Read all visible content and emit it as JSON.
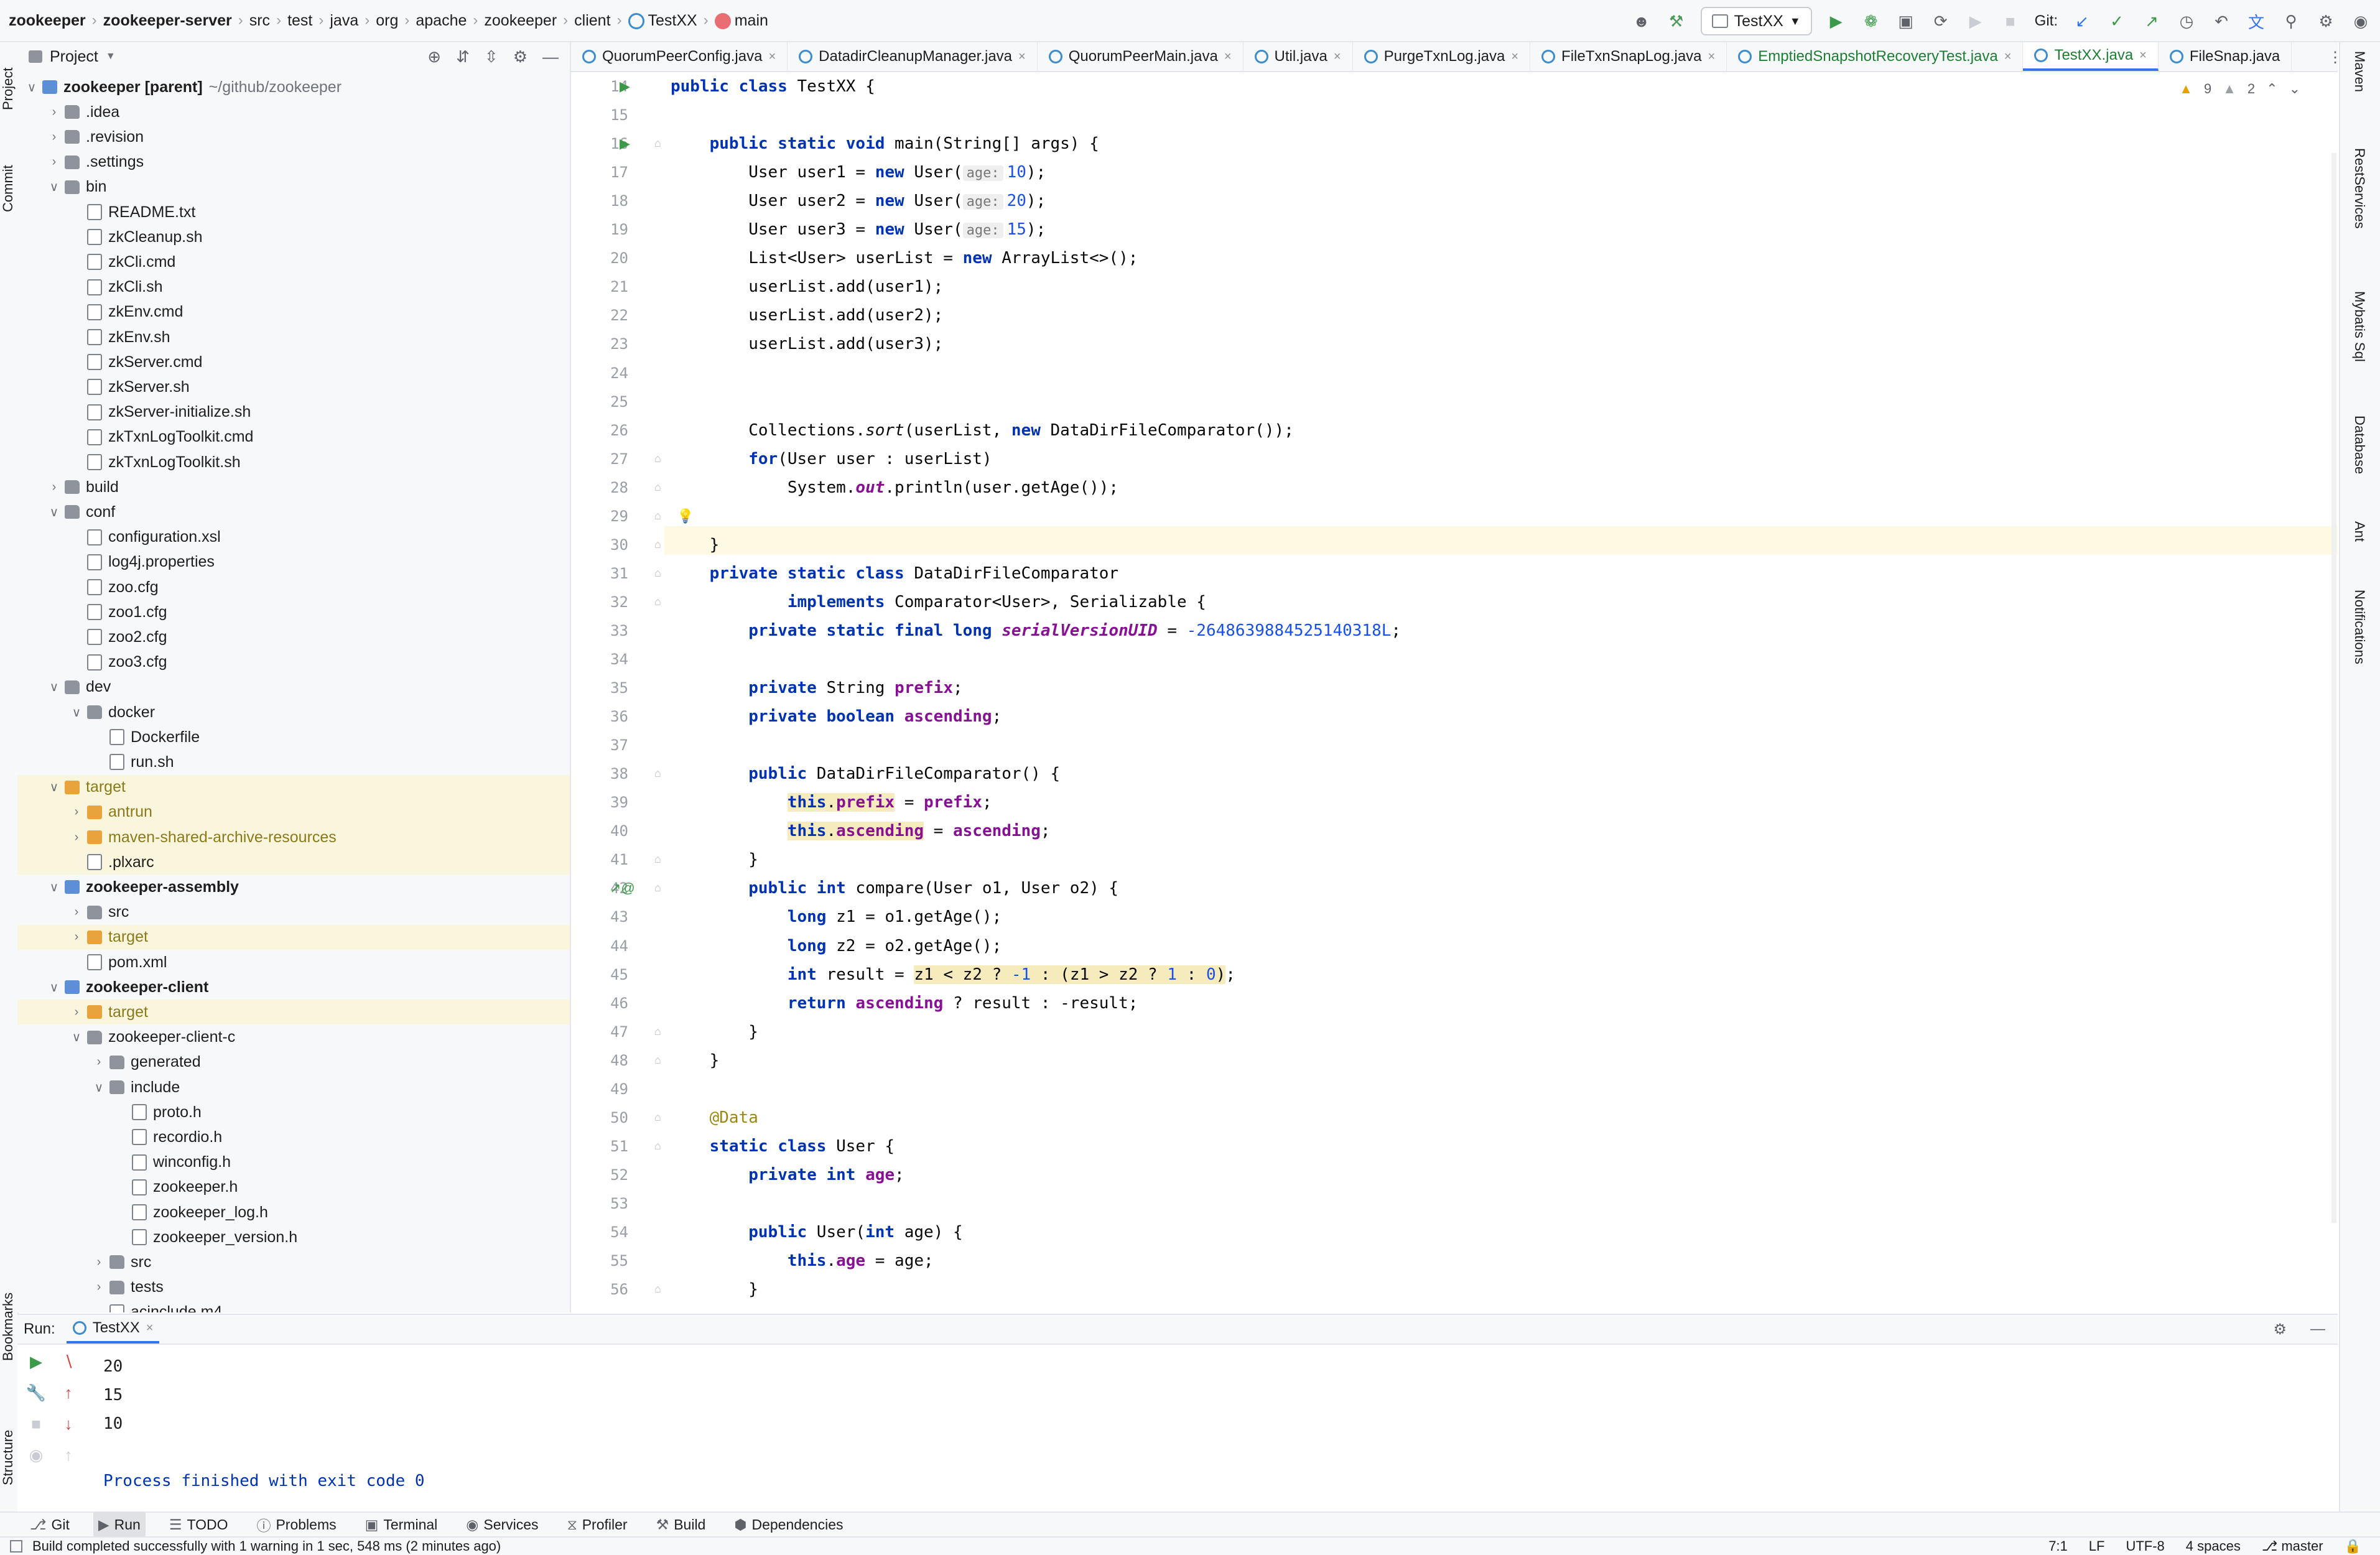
{
  "breadcrumbs": [
    "zookeeper",
    "zookeeper-server",
    "src",
    "test",
    "java",
    "org",
    "apache",
    "zookeeper",
    "client",
    "TestXX",
    "main"
  ],
  "toolbar": {
    "run_config": "TestXX",
    "git_label": "Git:"
  },
  "left_stripe": {
    "project": "Project",
    "commit": "Commit",
    "bookmarks": "Bookmarks",
    "structure": "Structure"
  },
  "right_stripe": [
    "Maven",
    "RestServices",
    "Mybatis Sql",
    "Database",
    "Ant",
    "Notifications"
  ],
  "project_panel": {
    "title": "Project",
    "tree": [
      {
        "label": "zookeeper [parent]",
        "path": "~/github/zookeeper",
        "depth": 0,
        "arrow": "down",
        "icon": "mod",
        "bold": true
      },
      {
        "label": ".idea",
        "depth": 1,
        "arrow": "right",
        "icon": "folder"
      },
      {
        "label": ".revision",
        "depth": 1,
        "arrow": "right",
        "icon": "folder"
      },
      {
        "label": ".settings",
        "depth": 1,
        "arrow": "right",
        "icon": "folder"
      },
      {
        "label": "bin",
        "depth": 1,
        "arrow": "down",
        "icon": "folder"
      },
      {
        "label": "README.txt",
        "depth": 2,
        "icon": "file"
      },
      {
        "label": "zkCleanup.sh",
        "depth": 2,
        "icon": "file"
      },
      {
        "label": "zkCli.cmd",
        "depth": 2,
        "icon": "file"
      },
      {
        "label": "zkCli.sh",
        "depth": 2,
        "icon": "file"
      },
      {
        "label": "zkEnv.cmd",
        "depth": 2,
        "icon": "file"
      },
      {
        "label": "zkEnv.sh",
        "depth": 2,
        "icon": "file"
      },
      {
        "label": "zkServer.cmd",
        "depth": 2,
        "icon": "file"
      },
      {
        "label": "zkServer.sh",
        "depth": 2,
        "icon": "file"
      },
      {
        "label": "zkServer-initialize.sh",
        "depth": 2,
        "icon": "file"
      },
      {
        "label": "zkTxnLogToolkit.cmd",
        "depth": 2,
        "icon": "file"
      },
      {
        "label": "zkTxnLogToolkit.sh",
        "depth": 2,
        "icon": "file"
      },
      {
        "label": "build",
        "depth": 1,
        "arrow": "right",
        "icon": "folder"
      },
      {
        "label": "conf",
        "depth": 1,
        "arrow": "down",
        "icon": "folder"
      },
      {
        "label": "configuration.xsl",
        "depth": 2,
        "icon": "file"
      },
      {
        "label": "log4j.properties",
        "depth": 2,
        "icon": "file"
      },
      {
        "label": "zoo.cfg",
        "depth": 2,
        "icon": "file"
      },
      {
        "label": "zoo1.cfg",
        "depth": 2,
        "icon": "file"
      },
      {
        "label": "zoo2.cfg",
        "depth": 2,
        "icon": "file"
      },
      {
        "label": "zoo3.cfg",
        "depth": 2,
        "icon": "file"
      },
      {
        "label": "dev",
        "depth": 1,
        "arrow": "down",
        "icon": "folder"
      },
      {
        "label": "docker",
        "depth": 2,
        "arrow": "down",
        "icon": "folder"
      },
      {
        "label": "Dockerfile",
        "depth": 3,
        "icon": "file"
      },
      {
        "label": "run.sh",
        "depth": 3,
        "icon": "file"
      },
      {
        "label": "target",
        "depth": 1,
        "arrow": "down",
        "icon": "ofolder",
        "hl": true
      },
      {
        "label": "antrun",
        "depth": 2,
        "arrow": "right",
        "icon": "ofolder",
        "hl": true
      },
      {
        "label": "maven-shared-archive-resources",
        "depth": 2,
        "arrow": "right",
        "icon": "ofolder",
        "hl": true
      },
      {
        "label": ".plxarc",
        "depth": 2,
        "icon": "file",
        "hl": true
      },
      {
        "label": "zookeeper-assembly",
        "depth": 1,
        "arrow": "down",
        "icon": "mod",
        "bold": true
      },
      {
        "label": "src",
        "depth": 2,
        "arrow": "right",
        "icon": "folder"
      },
      {
        "label": "target",
        "depth": 2,
        "arrow": "right",
        "icon": "ofolder",
        "hl": true
      },
      {
        "label": "pom.xml",
        "depth": 2,
        "icon": "file"
      },
      {
        "label": "zookeeper-client",
        "depth": 1,
        "arrow": "down",
        "icon": "mod",
        "bold": true
      },
      {
        "label": "target",
        "depth": 2,
        "arrow": "right",
        "icon": "ofolder",
        "hl": true
      },
      {
        "label": "zookeeper-client-c",
        "depth": 2,
        "arrow": "down",
        "icon": "folder"
      },
      {
        "label": "generated",
        "depth": 3,
        "arrow": "right",
        "icon": "folder"
      },
      {
        "label": "include",
        "depth": 3,
        "arrow": "down",
        "icon": "folder"
      },
      {
        "label": "proto.h",
        "depth": 4,
        "icon": "file"
      },
      {
        "label": "recordio.h",
        "depth": 4,
        "icon": "file"
      },
      {
        "label": "winconfig.h",
        "depth": 4,
        "icon": "file"
      },
      {
        "label": "zookeeper.h",
        "depth": 4,
        "icon": "file"
      },
      {
        "label": "zookeeper_log.h",
        "depth": 4,
        "icon": "file"
      },
      {
        "label": "zookeeper_version.h",
        "depth": 4,
        "icon": "file"
      },
      {
        "label": "src",
        "depth": 3,
        "arrow": "right",
        "icon": "folder"
      },
      {
        "label": "tests",
        "depth": 3,
        "arrow": "right",
        "icon": "folder"
      },
      {
        "label": "acinclude.m4",
        "depth": 3,
        "icon": "file"
      }
    ]
  },
  "tabs": [
    {
      "label": "QuorumPeerConfig.java",
      "green": false
    },
    {
      "label": "DatadirCleanupManager.java",
      "green": false
    },
    {
      "label": "QuorumPeerMain.java",
      "green": false
    },
    {
      "label": "Util.java",
      "green": false
    },
    {
      "label": "PurgeTxnLog.java",
      "green": false
    },
    {
      "label": "FileTxnSnapLog.java",
      "green": false
    },
    {
      "label": "EmptiedSnapshotRecoveryTest.java",
      "green": true
    },
    {
      "label": "TestXX.java",
      "green": true,
      "active": true
    },
    {
      "label": "FileSnap.java",
      "green": false
    }
  ],
  "inspection": {
    "warnings": "9",
    "weak_warnings": "2"
  },
  "code_lines": [
    {
      "n": 14,
      "html": "<span class='kw'>public class</span> TestXX {"
    },
    {
      "n": 15,
      "html": ""
    },
    {
      "n": 16,
      "html": "    <span class='kw'>public static void</span> main(String[] args) {"
    },
    {
      "n": 17,
      "html": "        User user1 = <span class='kw'>new</span> User(<span class='hint'>age:</span><span class='num'>10</span>);"
    },
    {
      "n": 18,
      "html": "        User user2 = <span class='kw'>new</span> User(<span class='hint'>age:</span><span class='num'>20</span>);"
    },
    {
      "n": 19,
      "html": "        User user3 = <span class='kw'>new</span> User(<span class='hint'>age:</span><span class='num'>15</span>);"
    },
    {
      "n": 20,
      "html": "        List&lt;User&gt; userList = <span class='kw'>new</span> ArrayList&lt;&gt;();"
    },
    {
      "n": 21,
      "html": "        userList.add(user1);"
    },
    {
      "n": 22,
      "html": "        userList.add(user2);"
    },
    {
      "n": 23,
      "html": "        userList.add(user3);"
    },
    {
      "n": 24,
      "html": ""
    },
    {
      "n": 25,
      "html": ""
    },
    {
      "n": 26,
      "html": "        Collections.<span class='it'>sort</span>(userList, <span class='kw'>new</span> DataDirFileComparator());"
    },
    {
      "n": 27,
      "html": "        <span class='kw'>for</span>(User user : userList)"
    },
    {
      "n": 28,
      "html": "            System.<span class='it fld'>out</span>.println(user.getAge());"
    },
    {
      "n": 29,
      "html": "        "
    },
    {
      "n": 30,
      "html": "    }"
    },
    {
      "n": 31,
      "html": "    <span class='kw'>private static class</span> DataDirFileComparator"
    },
    {
      "n": 32,
      "html": "            <span class='kw'>implements</span> Comparator&lt;User&gt;, Serializable {"
    },
    {
      "n": 33,
      "html": "        <span class='kw'>private static final long</span> <span class='fld it'>serialVersionUID</span> = <span class='num'>-2648639884525140318L</span>;"
    },
    {
      "n": 34,
      "html": ""
    },
    {
      "n": 35,
      "html": "        <span class='kw'>private</span> String <span class='fld'>prefix</span>;"
    },
    {
      "n": 36,
      "html": "        <span class='kw'>private boolean</span> <span class='fld'>ascending</span>;"
    },
    {
      "n": 37,
      "html": ""
    },
    {
      "n": 38,
      "html": "        <span class='kw'>public</span> DataDirFileComparator() {"
    },
    {
      "n": 39,
      "html": "            <span class='warnhl'><span class='kw'>this</span>.<span class='fld'>prefix</span></span> = <span class='fld'>prefix</span>;"
    },
    {
      "n": 40,
      "html": "            <span class='warnhl'><span class='kw'>this</span>.<span class='fld'>ascending</span></span> = <span class='fld'>ascending</span>;"
    },
    {
      "n": 41,
      "html": "        }"
    },
    {
      "n": 42,
      "html": "        <span class='kw'>public int</span> compare(User o1, User o2) {"
    },
    {
      "n": 43,
      "html": "            <span class='kw'>long</span> z1 = o1.getAge();"
    },
    {
      "n": 44,
      "html": "            <span class='kw'>long</span> z2 = o2.getAge();"
    },
    {
      "n": 45,
      "html": "            <span class='kw'>int</span> result = <span class='warnhl'>z1 &lt; z2 ? <span class='num'>-1</span> : (z1 &gt; z2 ? <span class='num'>1</span> : <span class='num'>0</span>)</span>;"
    },
    {
      "n": 46,
      "html": "            <span class='kw'>return</span> <span class='fld'>ascending</span> ? result : -result;"
    },
    {
      "n": 47,
      "html": "        }"
    },
    {
      "n": 48,
      "html": "    }"
    },
    {
      "n": 49,
      "html": ""
    },
    {
      "n": 50,
      "html": "    <span class='ann'>@Data</span>"
    },
    {
      "n": 51,
      "html": "    <span class='kw'>static class</span> User {"
    },
    {
      "n": 52,
      "html": "        <span class='kw'>private int</span> <span class='fld'>age</span>;"
    },
    {
      "n": 53,
      "html": ""
    },
    {
      "n": 54,
      "html": "        <span class='kw'>public</span> User(<span class='kw'>int</span> age) {"
    },
    {
      "n": 55,
      "html": "            <span class='kw'>this</span>.<span class='fld'>age</span> = age;"
    },
    {
      "n": 56,
      "html": "        }"
    }
  ],
  "run_panel": {
    "label": "Run:",
    "tab": "TestXX",
    "output": [
      "20",
      "15",
      "10",
      "",
      "Process finished with exit code 0"
    ]
  },
  "tool_windows": [
    "Git",
    "Run",
    "TODO",
    "Problems",
    "Terminal",
    "Services",
    "Profiler",
    "Build",
    "Dependencies"
  ],
  "status": {
    "message": "Build completed successfully with 1 warning in 1 sec, 548 ms (2 minutes ago)",
    "position": "7:1",
    "line_sep": "LF",
    "encoding": "UTF-8",
    "indent": "4 spaces",
    "branch": "master"
  }
}
